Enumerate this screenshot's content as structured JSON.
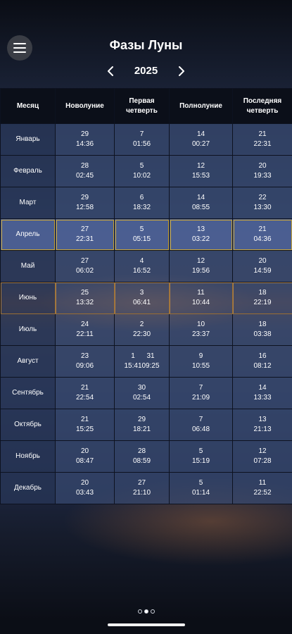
{
  "header": {
    "title": "Фазы Луны",
    "year": "2025"
  },
  "table": {
    "columns": [
      "Месяц",
      "Новолуние",
      "Первая четверть",
      "Полнолуние",
      "Последняя четверть"
    ],
    "rows": [
      {
        "month": "Январь",
        "new": {
          "day": "29",
          "time": "14:36"
        },
        "first": {
          "day": "7",
          "time": "01:56"
        },
        "full": {
          "day": "14",
          "time": "00:27"
        },
        "last": {
          "day": "21",
          "time": "22:31"
        }
      },
      {
        "month": "Февраль",
        "new": {
          "day": "28",
          "time": "02:45"
        },
        "first": {
          "day": "5",
          "time": "10:02"
        },
        "full": {
          "day": "12",
          "time": "15:53"
        },
        "last": {
          "day": "20",
          "time": "19:33"
        }
      },
      {
        "month": "Март",
        "new": {
          "day": "29",
          "time": "12:58"
        },
        "first": {
          "day": "6",
          "time": "18:32"
        },
        "full": {
          "day": "14",
          "time": "08:55"
        },
        "last": {
          "day": "22",
          "time": "13:30"
        }
      },
      {
        "month": "Апрель",
        "new": {
          "day": "27",
          "time": "22:31"
        },
        "first": {
          "day": "5",
          "time": "05:15"
        },
        "full": {
          "day": "13",
          "time": "03:22"
        },
        "last": {
          "day": "21",
          "time": "04:36"
        }
      },
      {
        "month": "Май",
        "new": {
          "day": "27",
          "time": "06:02"
        },
        "first": {
          "day": "4",
          "time": "16:52"
        },
        "full": {
          "day": "12",
          "time": "19:56"
        },
        "last": {
          "day": "20",
          "time": "14:59"
        }
      },
      {
        "month": "Июнь",
        "new": {
          "day": "25",
          "time": "13:32"
        },
        "first": {
          "day": "3",
          "time": "06:41"
        },
        "full": {
          "day": "11",
          "time": "10:44"
        },
        "last": {
          "day": "18",
          "time": "22:19"
        }
      },
      {
        "month": "Июль",
        "new": {
          "day": "24",
          "time": "22:11"
        },
        "first": {
          "day": "2",
          "time": "22:30"
        },
        "full": {
          "day": "10",
          "time": "23:37"
        },
        "last": {
          "day": "18",
          "time": "03:38"
        }
      },
      {
        "month": "Август",
        "new": {
          "day": "23",
          "time": "09:06"
        },
        "first": {
          "day": "1",
          "time": "15:41",
          "day2": "31",
          "time2": "09:25"
        },
        "full": {
          "day": "9",
          "time": "10:55"
        },
        "last": {
          "day": "16",
          "time": "08:12"
        }
      },
      {
        "month": "Сентябрь",
        "new": {
          "day": "21",
          "time": "22:54"
        },
        "first": {
          "day": "30",
          "time": "02:54"
        },
        "full": {
          "day": "7",
          "time": "21:09"
        },
        "last": {
          "day": "14",
          "time": "13:33"
        }
      },
      {
        "month": "Октябрь",
        "new": {
          "day": "21",
          "time": "15:25"
        },
        "first": {
          "day": "29",
          "time": "18:21"
        },
        "full": {
          "day": "7",
          "time": "06:48"
        },
        "last": {
          "day": "13",
          "time": "21:13"
        }
      },
      {
        "month": "Ноябрь",
        "new": {
          "day": "20",
          "time": "08:47"
        },
        "first": {
          "day": "28",
          "time": "08:59"
        },
        "full": {
          "day": "5",
          "time": "15:19"
        },
        "last": {
          "day": "12",
          "time": "07:28"
        }
      },
      {
        "month": "Декабрь",
        "new": {
          "day": "20",
          "time": "03:43"
        },
        "first": {
          "day": "27",
          "time": "21:10"
        },
        "full": {
          "day": "5",
          "time": "01:14"
        },
        "last": {
          "day": "11",
          "time": "22:52"
        }
      }
    ]
  },
  "pager": {
    "count": 3,
    "active": 1
  },
  "icons": {
    "menu": "hamburger-menu-icon",
    "prev": "chevron-left-icon",
    "next": "chevron-right-icon"
  },
  "colors": {
    "selected_border": "#c9a63a",
    "cell": "#374a70",
    "header": "#0b0f19"
  }
}
